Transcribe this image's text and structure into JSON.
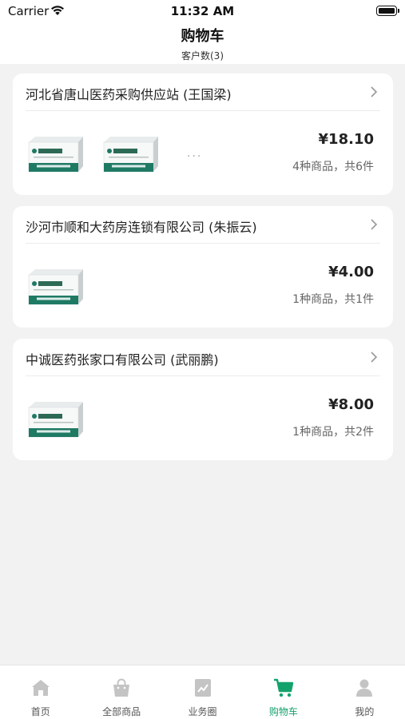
{
  "status_bar": {
    "carrier": "Carrier",
    "time": "11:32 AM"
  },
  "header": {
    "title": "购物车",
    "subtitle": "客户数(3)"
  },
  "carts": [
    {
      "customer": "河北省唐山医药采购供应站 (王国梁)",
      "price": "¥18.10",
      "count": "4种商品，共6件",
      "more": "···"
    },
    {
      "customer": "沙河市顺和大药房连锁有限公司 (朱振云)",
      "price": "¥4.00",
      "count": "1种商品，共1件"
    },
    {
      "customer": "中诚医药张家口有限公司 (武丽鹏)",
      "price": "¥8.00",
      "count": "1种商品，共2件"
    }
  ],
  "tab_bar": {
    "active_index": 3,
    "active_color": "#14a26c",
    "tabs": [
      {
        "label": "首页",
        "icon": "home-icon"
      },
      {
        "label": "全部商品",
        "icon": "shopping-bag-icon"
      },
      {
        "label": "业务圈",
        "icon": "chart-icon"
      },
      {
        "label": "购物车",
        "icon": "cart-icon"
      },
      {
        "label": "我的",
        "icon": "user-icon"
      }
    ]
  }
}
